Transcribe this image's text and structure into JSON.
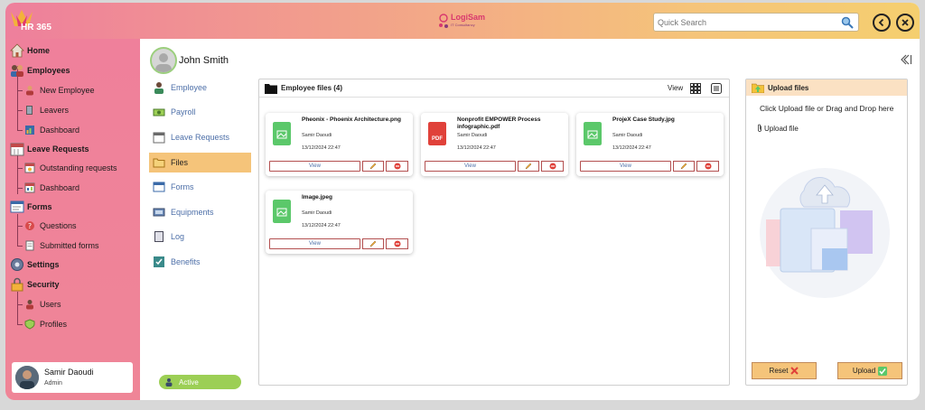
{
  "app": {
    "title": "HR 365",
    "brand_name": "LogiSam",
    "brand_tagline": "IT Consultancy"
  },
  "search": {
    "placeholder": "Quick Search"
  },
  "sidebar": {
    "home": "Home",
    "employees": "Employees",
    "new_employee": "New Employee",
    "leavers": "Leavers",
    "dashboard1": "Dashboard",
    "leave_requests": "Leave Requests",
    "outstanding": "Outstanding requests",
    "dashboard2": "Dashboard",
    "forms": "Forms",
    "questions": "Questions",
    "submitted_forms": "Submitted forms",
    "settings": "Settings",
    "security": "Security",
    "users": "Users",
    "profiles": "Profiles"
  },
  "current_user": {
    "name": "Samir Daoudi",
    "role": "Admin"
  },
  "employee": {
    "name": "John Smith",
    "status": "Active"
  },
  "subnav": {
    "employee": "Employee",
    "payroll": "Payroll",
    "leave_requests": "Leave Requests",
    "files": "Files",
    "forms": "Forms",
    "equipments": "Equipments",
    "log": "Log",
    "benefits": "Benefits"
  },
  "files_panel": {
    "title": "Employee files (4)",
    "view_label": "View",
    "files": [
      {
        "name": "Pheonix - Phoenix Architecture.png",
        "owner": "Samir Daoudi",
        "date": "13/12/2024 22:47",
        "type": "image"
      },
      {
        "name": "Nonprofit EMPOWER Process infographic.pdf",
        "owner": "Samir Daoudi",
        "date": "13/12/2024 22:47",
        "type": "pdf"
      },
      {
        "name": "ProjeX Case Study.jpg",
        "owner": "Samir Daoudi",
        "date": "13/12/2024 22:47",
        "type": "image"
      },
      {
        "name": "Image.jpeg",
        "owner": "Samir Daoudi",
        "date": "13/12/2024 22:47",
        "type": "image"
      }
    ],
    "view_button": "View",
    "pdf_badge": "PDF"
  },
  "upload_panel": {
    "title": "Upload files",
    "hint": "Click Upload file or Drag and Drop here",
    "link": "Upload file",
    "reset_label": "Reset",
    "upload_label": "Upload"
  },
  "colors": {
    "accent": "#f5c47a",
    "sidebar": "#ef809b",
    "image_file": "#5bc86a",
    "pdf_file": "#e0413a"
  }
}
